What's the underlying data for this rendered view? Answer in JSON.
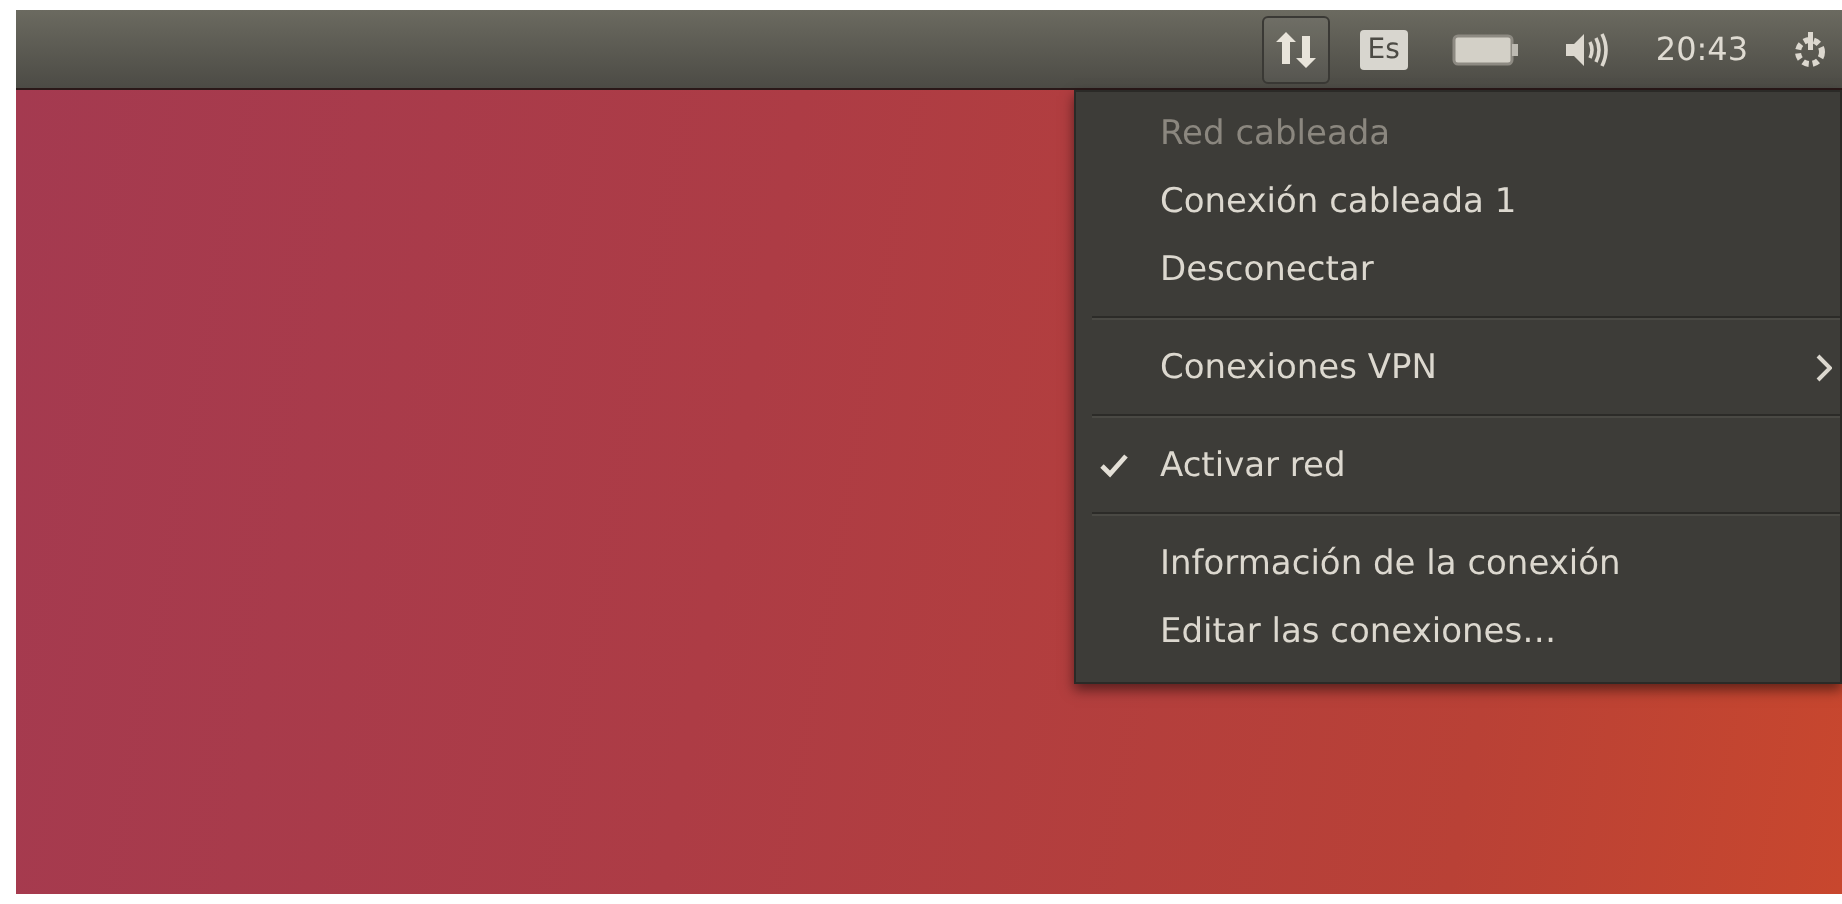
{
  "panel": {
    "indicators": [
      {
        "kind": "network",
        "selected": true
      },
      {
        "kind": "keyboard",
        "label": "Es",
        "selected": false
      },
      {
        "kind": "battery",
        "selected": false
      },
      {
        "kind": "sound",
        "selected": false
      },
      {
        "kind": "clock",
        "label": "20:43",
        "selected": false
      },
      {
        "kind": "session",
        "selected": false
      }
    ]
  },
  "menu": {
    "sections": [
      [
        {
          "kind": "item",
          "label": "Red cableada",
          "disabled": true
        },
        {
          "kind": "item",
          "label": "Conexión cableada 1",
          "disabled": false
        },
        {
          "kind": "item",
          "label": "Desconectar",
          "disabled": false
        }
      ],
      [
        {
          "kind": "submenu",
          "label": "Conexiones VPN",
          "disabled": false
        }
      ],
      [
        {
          "kind": "check",
          "label": "Activar red",
          "checked": true,
          "disabled": false
        }
      ],
      [
        {
          "kind": "item",
          "label": "Información de la conexión",
          "disabled": false
        },
        {
          "kind": "item",
          "label": "Editar las conexiones…",
          "disabled": false
        }
      ]
    ]
  }
}
